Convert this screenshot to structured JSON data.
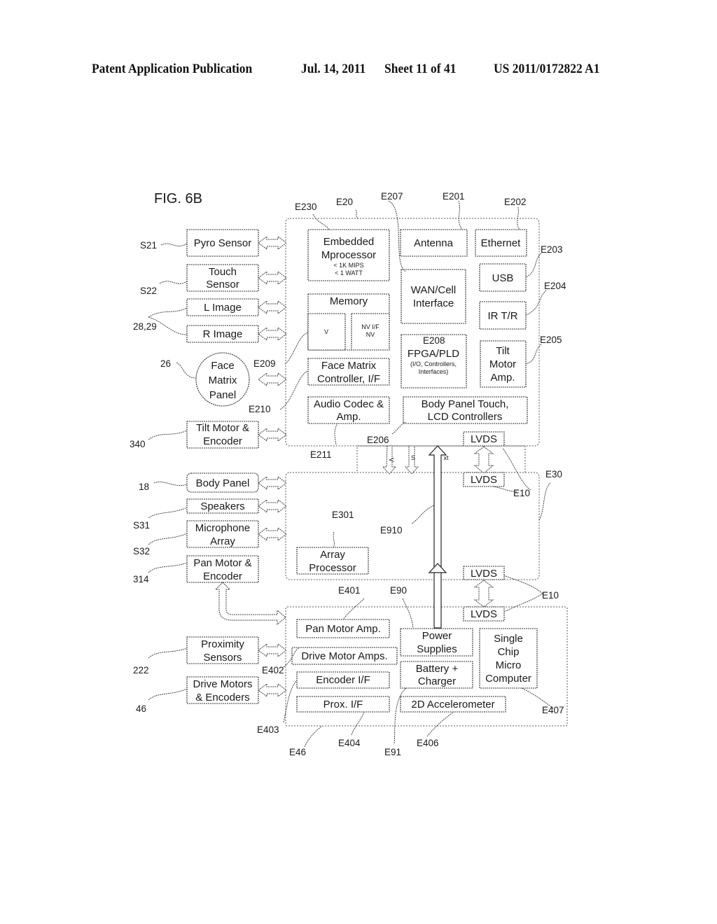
{
  "header": {
    "publication": "Patent Application Publication",
    "date": "Jul. 14, 2011",
    "sheet": "Sheet 11 of 41",
    "number": "US 2011/0172822 A1"
  },
  "figure": {
    "title": "FIG. 6B"
  },
  "peripherals": {
    "pyro": "Pyro Sensor",
    "touch1": "Touch",
    "touch2": "Sensor",
    "limage": "L Image",
    "rimage": "R Image",
    "face1": "Face",
    "face2": "Matrix",
    "face3": "Panel",
    "tilt1": "Tilt Motor &",
    "tilt2": "Encoder",
    "body": "Body Panel",
    "speakers": "Speakers",
    "mic1": "Microphone",
    "mic2": "Array",
    "pan1": "Pan Motor &",
    "pan2": "Encoder",
    "prox1": "Proximity",
    "prox2": "Sensors",
    "drive1": "Drive Motors",
    "drive2": "& Encoders"
  },
  "peripheral_refs": {
    "s21": "S21",
    "s22": "S22",
    "r2829": "28,29",
    "r26": "26",
    "r340": "340",
    "r18": "18",
    "s31": "S31",
    "s32": "S32",
    "r314": "314",
    "r222": "222",
    "r46": "46"
  },
  "e20": {
    "emb1": "Embedded",
    "emb2": "Mprocessor",
    "emb3": "< 1K MIPS",
    "emb4": "< 1 WATT",
    "antenna": "Antenna",
    "ethernet": "Ethernet",
    "usb": "USB",
    "irtr": "IR T/R",
    "wan1": "WAN/Cell",
    "wan2": "Interface",
    "memory": "Memory",
    "mem_v": "V",
    "mem_nv1": "NV I/F",
    "mem_nv2": "NV",
    "fpga_ref": "E208",
    "fpga1": "FPGA/PLD",
    "fpga2": "(I/O, Controllers,",
    "fpga3": "Interfaces)",
    "tiltamp1": "Tilt",
    "tiltamp2": "Motor",
    "tiltamp3": "Amp.",
    "face1": "Face Matrix",
    "face2": "Controller, I/F",
    "audio1": "Audio Codec &",
    "audio2": "Amp.",
    "bodyp1": "Body Panel Touch,",
    "bodyp2": "LCD Controllers",
    "lvds": "LVDS"
  },
  "e30": {
    "lvds_top": "LVDS",
    "lvds_bot": "LVDS",
    "array1": "Array",
    "array2": "Processor"
  },
  "bus_labels": {
    "v": "V",
    "s": "S",
    "xt": "xt"
  },
  "e46": {
    "lvds": "LVDS",
    "panamp": "Pan Motor Amp.",
    "driveamps": "Drive Motor Amps.",
    "encoder": "Encoder I/F",
    "prox": "Prox. I/F",
    "power1": "Power",
    "power2": "Supplies",
    "batt1": "Battery +",
    "batt2": "Charger",
    "accel": "2D Accelerometer",
    "scm1": "Single",
    "scm2": "Chip",
    "scm3": "Micro",
    "scm4": "Computer"
  },
  "refs": {
    "e230": "E230",
    "e20": "E20",
    "e207": "E207",
    "e201": "E201",
    "e202": "E202",
    "e203": "E203",
    "e204": "E204",
    "e205": "E205",
    "e209": "E209",
    "e210": "E210",
    "e206": "E206",
    "e211": "E211",
    "e10a": "E10",
    "e30": "E30",
    "e301": "E301",
    "e910": "E910",
    "e10b": "E10",
    "e401": "E401",
    "e90": "E90",
    "e402": "E402",
    "e403": "E403",
    "e46": "E46",
    "e404": "E404",
    "e91": "E91",
    "e406": "E406",
    "e407": "E407"
  }
}
